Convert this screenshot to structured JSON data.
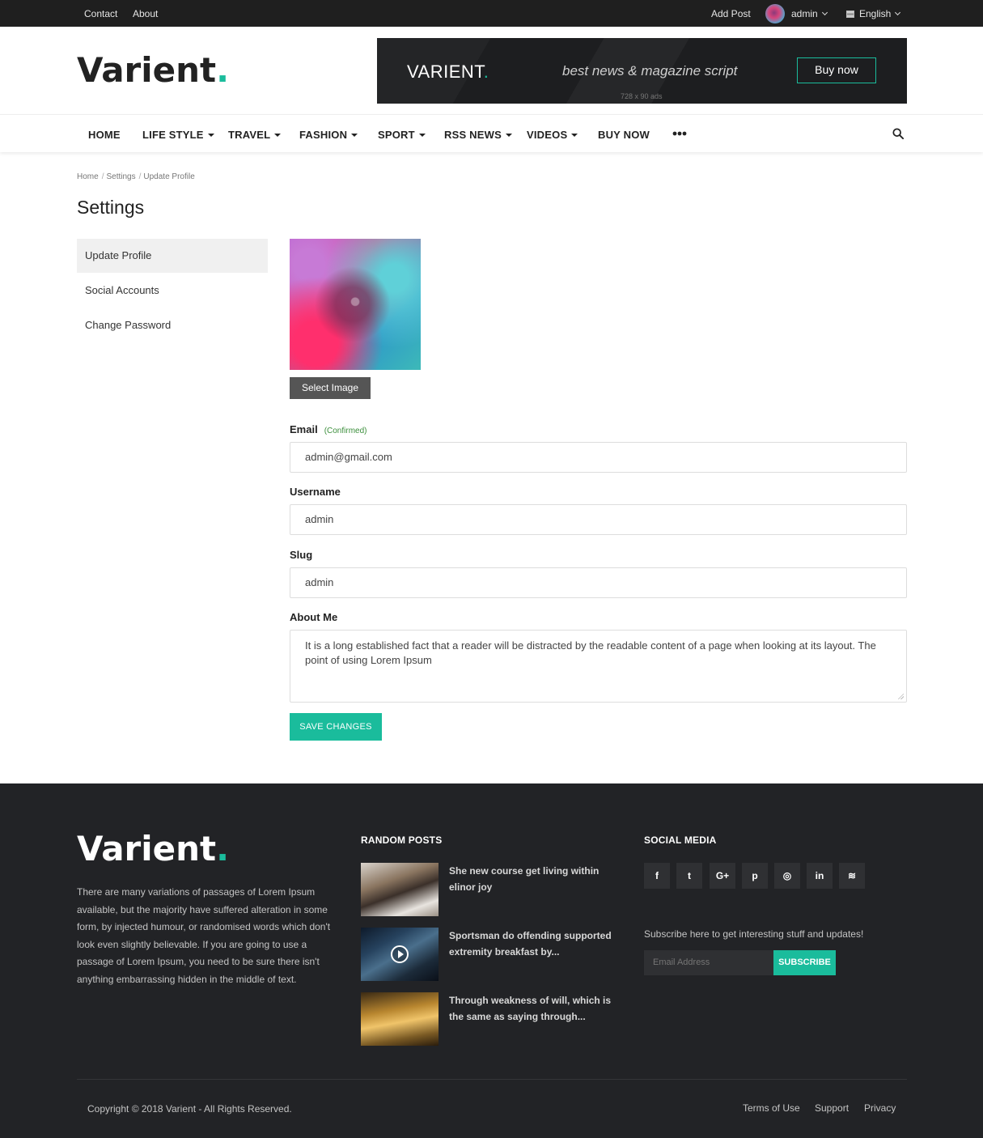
{
  "topbar": {
    "links": [
      "Contact",
      "About"
    ],
    "add_post": "Add Post",
    "user": "admin",
    "language": "English"
  },
  "header": {
    "logo_text": "Varient",
    "logo_dot": ".",
    "banner": {
      "logo_text": "VARIENT",
      "logo_dot": ".",
      "tagline": "best news & magazine script",
      "button": "Buy now",
      "size_note": "728 x 90 ads"
    }
  },
  "nav": {
    "items": [
      {
        "label": "HOME",
        "dropdown": false
      },
      {
        "label": "LIFE STYLE",
        "dropdown": true
      },
      {
        "label": "TRAVEL",
        "dropdown": true
      },
      {
        "label": "FASHION",
        "dropdown": true
      },
      {
        "label": "SPORT",
        "dropdown": true
      },
      {
        "label": "RSS NEWS",
        "dropdown": true
      },
      {
        "label": "VIDEOS",
        "dropdown": true
      },
      {
        "label": "BUY NOW",
        "dropdown": false
      }
    ],
    "more_icon": "more-dots-icon",
    "search_icon": "search-icon"
  },
  "breadcrumb": [
    "Home",
    "Settings",
    "Update Profile"
  ],
  "page_title": "Settings",
  "sidebar": {
    "items": [
      "Update Profile",
      "Social Accounts",
      "Change Password"
    ],
    "active_index": 0
  },
  "profile": {
    "select_image": "Select Image",
    "email_label": "Email",
    "email_status": "(Confirmed)",
    "email_value": "admin@gmail.com",
    "username_label": "Username",
    "username_value": "admin",
    "slug_label": "Slug",
    "slug_value": "admin",
    "about_label": "About Me",
    "about_value": "It is a long established fact that a reader will be distracted by the readable content of a page when looking at its layout. The point of using Lorem Ipsum",
    "save_button": "SAVE CHANGES"
  },
  "footer": {
    "logo_text": "Varient",
    "logo_dot": ".",
    "about": "There are many variations of passages of Lorem Ipsum available, but the majority have suffered alteration in some form, by injected humour, or randomised words which don't look even slightly believable. If you are going to use a passage of Lorem Ipsum, you need to be sure there isn't anything embarrassing hidden in the middle of text.",
    "random_posts_heading": "RANDOM POSTS",
    "posts": [
      {
        "title": "She new course get living within elinor joy"
      },
      {
        "title": "Sportsman do offending supported extremity breakfast by..."
      },
      {
        "title": "Through weakness of will, which is the same as saying through..."
      }
    ],
    "social_heading": "SOCIAL MEDIA",
    "social_icons": [
      {
        "name": "facebook-icon",
        "glyph": "f"
      },
      {
        "name": "twitter-icon",
        "glyph": "t"
      },
      {
        "name": "google-plus-icon",
        "glyph": "G+"
      },
      {
        "name": "pinterest-icon",
        "glyph": "p"
      },
      {
        "name": "instagram-icon",
        "glyph": "◎"
      },
      {
        "name": "linkedin-icon",
        "glyph": "in"
      },
      {
        "name": "rss-icon",
        "glyph": "≋"
      }
    ],
    "subscribe_text": "Subscribe here to get interesting stuff and updates!",
    "email_placeholder": "Email Address",
    "subscribe_button": "SUBSCRIBE",
    "copyright": "Copyright © 2018 Varient - All Rights Reserved.",
    "links": [
      "Terms of Use",
      "Support",
      "Privacy"
    ]
  },
  "colors": {
    "accent": "#1abc9c",
    "topbar_bg": "#1f1f1f",
    "footer_bg": "#222326"
  }
}
